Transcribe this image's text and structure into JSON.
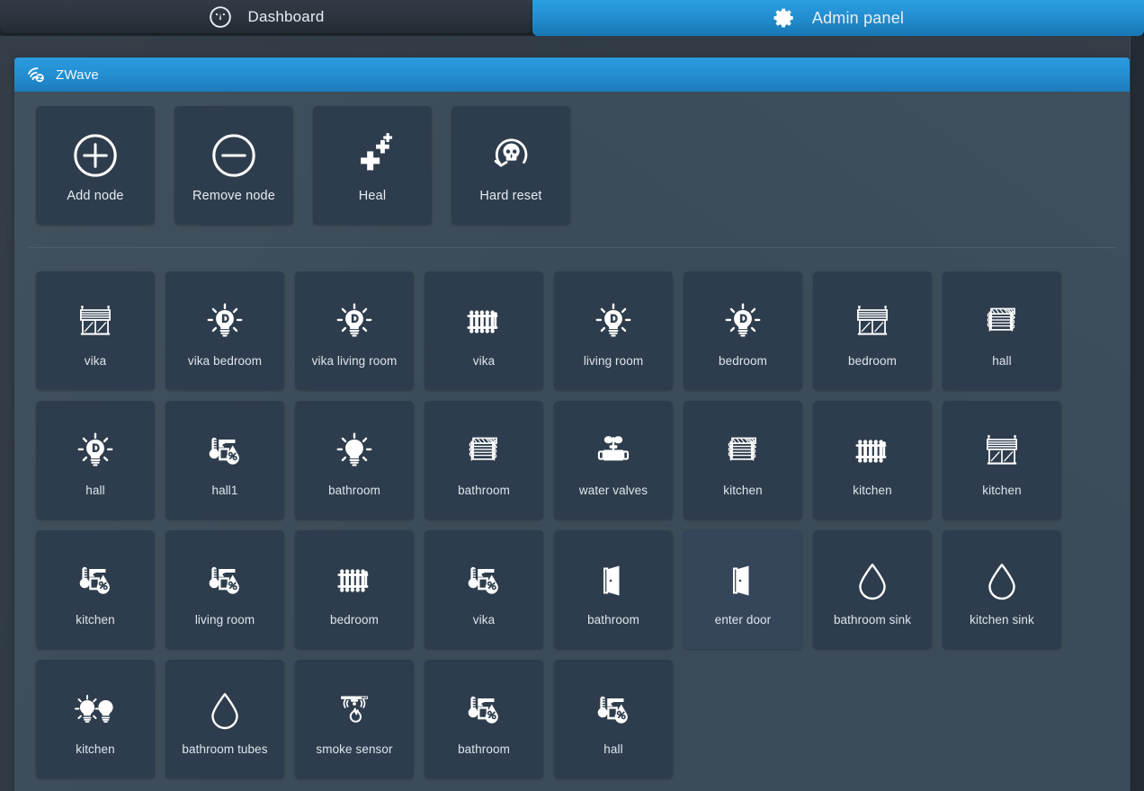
{
  "tabs": [
    {
      "label": "Dashboard",
      "icon": "gauge-icon",
      "active": false
    },
    {
      "label": "Admin panel",
      "icon": "gear-icon",
      "active": true
    }
  ],
  "panel": {
    "title": "ZWave",
    "icon": "zwave-signal-icon",
    "accent_color": "#2490d4",
    "background_color": "#3b4b58",
    "tile_color": "#2e3d4d",
    "tile_hover_color": "#35455a",
    "label_color": "#dde5ec"
  },
  "actions": [
    {
      "label": "Add node",
      "icon": "plus-circle-icon"
    },
    {
      "label": "Remove node",
      "icon": "minus-circle-icon"
    },
    {
      "label": "Heal",
      "icon": "sparkle-crosses-icon"
    },
    {
      "label": "Hard reset",
      "icon": "skull-reset-icon"
    }
  ],
  "devices": [
    {
      "label": "vika",
      "icon": "blinds-window-icon",
      "hover": false
    },
    {
      "label": "vika bedroom",
      "icon": "dimmer-bulb-icon",
      "hover": false
    },
    {
      "label": "vika living room",
      "icon": "dimmer-bulb-icon",
      "hover": false
    },
    {
      "label": "vika",
      "icon": "radiator-icon",
      "hover": false
    },
    {
      "label": "living room",
      "icon": "dimmer-bulb-icon",
      "hover": false
    },
    {
      "label": "bedroom",
      "icon": "dimmer-bulb-icon",
      "hover": false
    },
    {
      "label": "bedroom",
      "icon": "blinds-window-icon",
      "hover": false
    },
    {
      "label": "hall",
      "icon": "blinds-roller-icon",
      "hover": false
    },
    {
      "label": "hall",
      "icon": "dimmer-bulb-icon",
      "hover": false
    },
    {
      "label": "hall1",
      "icon": "temp-humidity-icon",
      "hover": false
    },
    {
      "label": "bathroom",
      "icon": "bulb-icon",
      "hover": false
    },
    {
      "label": "bathroom",
      "icon": "blinds-roller-icon",
      "hover": false
    },
    {
      "label": "water valves",
      "icon": "water-valve-icon",
      "hover": false
    },
    {
      "label": "kitchen",
      "icon": "blinds-roller-icon",
      "hover": false
    },
    {
      "label": "kitchen",
      "icon": "radiator-icon",
      "hover": false
    },
    {
      "label": "kitchen",
      "icon": "blinds-window-icon",
      "hover": false
    },
    {
      "label": "kitchen",
      "icon": "temp-humidity-icon",
      "hover": false
    },
    {
      "label": "living room",
      "icon": "temp-humidity-icon",
      "hover": false
    },
    {
      "label": "bedroom",
      "icon": "radiator-icon",
      "hover": false
    },
    {
      "label": "vika",
      "icon": "temp-humidity-icon",
      "hover": false
    },
    {
      "label": "bathroom",
      "icon": "open-door-icon",
      "hover": false
    },
    {
      "label": "enter door",
      "icon": "open-door-icon",
      "hover": true
    },
    {
      "label": "bathroom sink",
      "icon": "water-drop-icon",
      "hover": false
    },
    {
      "label": "kitchen sink",
      "icon": "water-drop-icon",
      "hover": false
    },
    {
      "label": "kitchen",
      "icon": "double-bulb-icon",
      "hover": false
    },
    {
      "label": "bathroom tubes",
      "icon": "water-drop-icon",
      "hover": false
    },
    {
      "label": "smoke sensor",
      "icon": "smoke-detector-icon",
      "hover": false
    },
    {
      "label": "bathroom",
      "icon": "temp-humidity-icon",
      "hover": false
    },
    {
      "label": "hall",
      "icon": "temp-humidity-icon",
      "hover": false
    }
  ]
}
